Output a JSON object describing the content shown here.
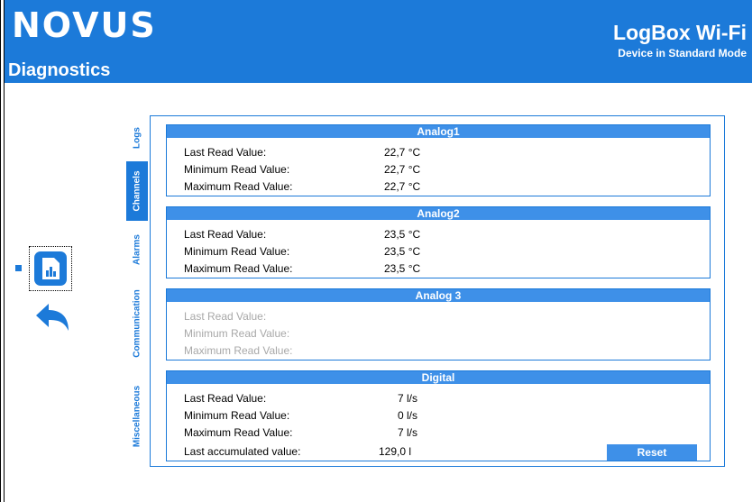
{
  "header": {
    "logo": "NOVUS",
    "page_title": "Diagnostics",
    "product_name": "LogBox Wi-Fi",
    "device_mode": "Device in Standard Mode"
  },
  "tabs": [
    {
      "label": "Logs",
      "active": false
    },
    {
      "label": "Channels",
      "active": true
    },
    {
      "label": "Alarms",
      "active": false
    },
    {
      "label": "Communication",
      "active": false
    },
    {
      "label": "Miscellaneous",
      "active": false
    }
  ],
  "labels": {
    "last": "Last Read Value:",
    "min": "Minimum Read Value:",
    "max": "Maximum Read Value:",
    "accumulated": "Last accumulated value:"
  },
  "channels": [
    {
      "title": "Analog1",
      "last": "22,7 °C",
      "min": "22,7 °C",
      "max": "22,7 °C"
    },
    {
      "title": "Analog2",
      "last": "23,5 °C",
      "min": "23,5 °C",
      "max": "23,5 °C"
    },
    {
      "title": "Analog 3",
      "last": "",
      "min": "",
      "max": ""
    },
    {
      "title": "Digital",
      "last": "7 l/s",
      "min": "0 l/s",
      "max": "7 l/s",
      "accumulated": "129,0 l"
    }
  ],
  "reset_label": "Reset",
  "icons": {
    "app": "bar-chart-icon",
    "back": "back-arrow-icon"
  },
  "colors": {
    "brand_blue": "#1c7ad9",
    "card_header_blue": "#3e90e8",
    "disabled_text": "#a8a8a8"
  }
}
